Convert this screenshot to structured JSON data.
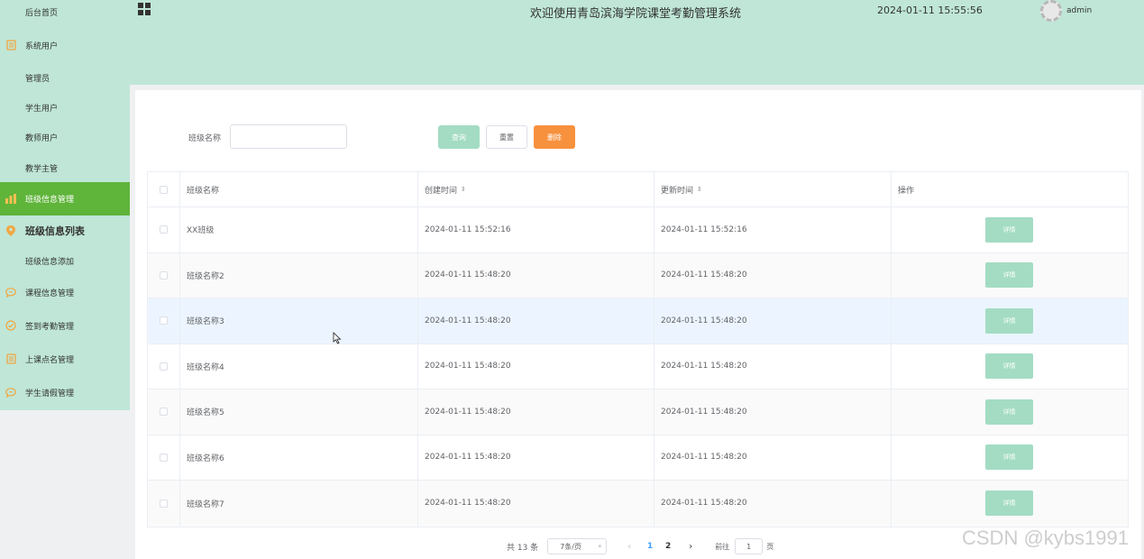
{
  "header": {
    "title": "欢迎使用青岛滨海学院课堂考勤管理系统",
    "datetime": "2024-01-11 15:55:56",
    "username": "admin"
  },
  "sidebar": {
    "items": [
      {
        "label": "后台首页",
        "icon": null
      },
      {
        "label": "系统用户",
        "icon": "document-icon"
      },
      {
        "label": "管理员",
        "icon": null
      },
      {
        "label": "学生用户",
        "icon": null
      },
      {
        "label": "教师用户",
        "icon": null
      },
      {
        "label": "教学主管",
        "icon": null
      },
      {
        "label": "班级信息管理",
        "icon": "chart-icon"
      },
      {
        "label": "班级信息列表",
        "icon": "location-icon"
      },
      {
        "label": "班级信息添加",
        "icon": null
      },
      {
        "label": "课程信息管理",
        "icon": "chat-icon"
      },
      {
        "label": "签到考勤管理",
        "icon": "check-circle-icon"
      },
      {
        "label": "上课点名管理",
        "icon": "document-icon"
      },
      {
        "label": "学生请假管理",
        "icon": "chat-icon"
      }
    ],
    "accent_color": "#5fb43a",
    "background_color": "#bfe6d7"
  },
  "search": {
    "label": "班级名称",
    "value": "",
    "placeholder": ""
  },
  "buttons": {
    "query": "查询",
    "reset": "重置",
    "delete": "删除"
  },
  "table": {
    "columns": [
      "班级名称",
      "创建时间",
      "更新时间",
      "操作"
    ],
    "sort_icon": "⇕",
    "action_label": "详情",
    "rows": [
      {
        "name": "XX班级",
        "created": "2024-01-11 15:52:16",
        "updated": "2024-01-11 15:52:16"
      },
      {
        "name": "班级名称2",
        "created": "2024-01-11 15:48:20",
        "updated": "2024-01-11 15:48:20"
      },
      {
        "name": "班级名称3",
        "created": "2024-01-11 15:48:20",
        "updated": "2024-01-11 15:48:20"
      },
      {
        "name": "班级名称4",
        "created": "2024-01-11 15:48:20",
        "updated": "2024-01-11 15:48:20"
      },
      {
        "name": "班级名称5",
        "created": "2024-01-11 15:48:20",
        "updated": "2024-01-11 15:48:20"
      },
      {
        "name": "班级名称6",
        "created": "2024-01-11 15:48:20",
        "updated": "2024-01-11 15:48:20"
      },
      {
        "name": "班级名称7",
        "created": "2024-01-11 15:48:20",
        "updated": "2024-01-11 15:48:20"
      }
    ]
  },
  "pagination": {
    "total": "共 13 条",
    "page_size": "7条/页",
    "pages": [
      "1",
      "2"
    ],
    "current": "1",
    "goto_label": "前往",
    "goto_value": "1",
    "page_unit": "页"
  },
  "watermark": "CSDN @kybs1991"
}
